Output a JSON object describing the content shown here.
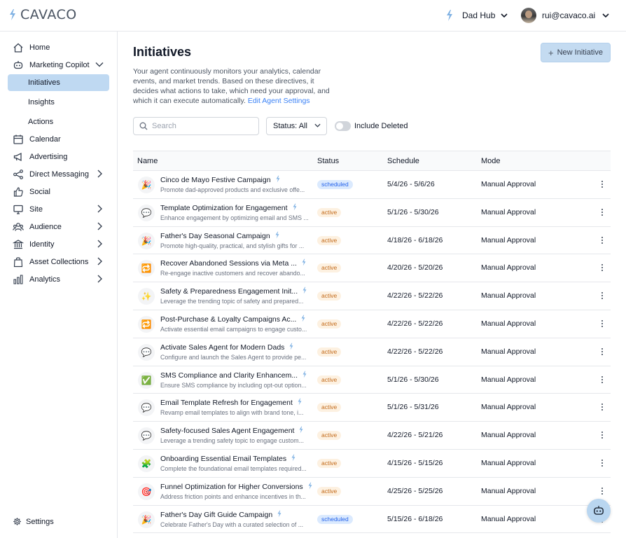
{
  "brand": {
    "name": "CAVACO"
  },
  "header": {
    "hub_label": "Dad Hub",
    "user_email": "rui@cavaco.ai"
  },
  "sidebar": {
    "items": [
      {
        "label": "Home",
        "icon": "home-icon"
      },
      {
        "label": "Marketing Copilot",
        "icon": "robot-icon",
        "expanded": true
      },
      {
        "label": "Calendar",
        "icon": "calendar-icon"
      },
      {
        "label": "Advertising",
        "icon": "megaphone-icon"
      },
      {
        "label": "Direct Messaging",
        "icon": "share-icon",
        "has_children": true
      },
      {
        "label": "Social",
        "icon": "thumbs-up-icon"
      },
      {
        "label": "Site",
        "icon": "monitor-icon",
        "has_children": true
      },
      {
        "label": "Audience",
        "icon": "users-icon",
        "has_children": true
      },
      {
        "label": "Identity",
        "icon": "bank-icon",
        "has_children": true
      },
      {
        "label": "Asset Collections",
        "icon": "bag-icon",
        "has_children": true
      },
      {
        "label": "Analytics",
        "icon": "bar-chart-icon",
        "has_children": true
      }
    ],
    "sub_items": [
      {
        "label": "Initiatives",
        "active": true
      },
      {
        "label": "Insights"
      },
      {
        "label": "Actions"
      }
    ],
    "settings_label": "Settings"
  },
  "page": {
    "title": "Initiatives",
    "description": "Your agent continuously monitors your analytics, calendar events, and market trends. Based on these directives, it decides what actions to take, which need your approval, and which it can execute automatically.",
    "edit_link": "Edit Agent Settings",
    "new_button": "New Initiative"
  },
  "filters": {
    "search_placeholder": "Search",
    "status_label": "Status: All",
    "include_deleted_label": "Include Deleted",
    "include_deleted": false
  },
  "table": {
    "columns": [
      "Name",
      "Status",
      "Schedule",
      "Mode"
    ],
    "rows": [
      {
        "emoji": "🎉",
        "name": "Cinco de Mayo Festive Campaign",
        "desc": "Promote dad-approved products and exclusive offe...",
        "status": "scheduled",
        "schedule": "5/4/26 - 5/6/26",
        "mode": "Manual Approval"
      },
      {
        "emoji": "💬",
        "name": "Template Optimization for Engagement",
        "desc": "Enhance engagement by optimizing email and SMS ...",
        "status": "active",
        "schedule": "5/1/26 - 5/30/26",
        "mode": "Manual Approval"
      },
      {
        "emoji": "🎉",
        "name": "Father's Day Seasonal Campaign",
        "desc": "Promote high-quality, practical, and stylish gifts for ...",
        "status": "active",
        "schedule": "4/18/26 - 6/18/26",
        "mode": "Manual Approval"
      },
      {
        "emoji": "🔁",
        "name": "Recover Abandoned Sessions via Meta ...",
        "desc": "Re-engage inactive customers and recover abando...",
        "status": "active",
        "schedule": "4/20/26 - 5/20/26",
        "mode": "Manual Approval"
      },
      {
        "emoji": "✨",
        "name": "Safety & Preparedness Engagement Init...",
        "desc": "Leverage the trending topic of safety and prepared...",
        "status": "active",
        "schedule": "4/22/26 - 5/22/26",
        "mode": "Manual Approval"
      },
      {
        "emoji": "🔁",
        "name": "Post-Purchase & Loyalty Campaigns Ac...",
        "desc": "Activate essential email campaigns to engage custo...",
        "status": "active",
        "schedule": "4/22/26 - 5/22/26",
        "mode": "Manual Approval"
      },
      {
        "emoji": "💬",
        "name": "Activate Sales Agent for Modern Dads",
        "desc": "Configure and launch the Sales Agent to provide pe...",
        "status": "active",
        "schedule": "4/22/26 - 5/22/26",
        "mode": "Manual Approval"
      },
      {
        "emoji": "✅",
        "name": "SMS Compliance and Clarity Enhancem...",
        "desc": "Ensure SMS compliance by including opt-out option...",
        "status": "active",
        "schedule": "5/1/26 - 5/30/26",
        "mode": "Manual Approval"
      },
      {
        "emoji": "💬",
        "name": "Email Template Refresh for Engagement",
        "desc": "Revamp email templates to align with brand tone, i...",
        "status": "active",
        "schedule": "5/1/26 - 5/31/26",
        "mode": "Manual Approval"
      },
      {
        "emoji": "💬",
        "name": "Safety-focused Sales Agent Engagement",
        "desc": "Leverage a trending safety topic to engage custom...",
        "status": "active",
        "schedule": "4/22/26 - 5/21/26",
        "mode": "Manual Approval"
      },
      {
        "emoji": "🧩",
        "name": "Onboarding Essential Email Templates",
        "desc": "Complete the foundational email templates required...",
        "status": "active",
        "schedule": "4/15/26 - 5/15/26",
        "mode": "Manual Approval"
      },
      {
        "emoji": "🎯",
        "name": "Funnel Optimization for Higher Conversions",
        "desc": "Address friction points and enhance incentives in th...",
        "status": "active",
        "schedule": "4/25/26 - 5/25/26",
        "mode": "Manual Approval"
      },
      {
        "emoji": "🎉",
        "name": "Father's Day Gift Guide Campaign",
        "desc": "Celebrate Father's Day with a curated selection of ...",
        "status": "scheduled",
        "schedule": "5/15/26 - 6/18/26",
        "mode": "Manual Approval"
      }
    ]
  },
  "colors": {
    "accent": "#3b82f6",
    "active_nav": "#bfd9f2",
    "primary_button": "#c4dbf1"
  }
}
